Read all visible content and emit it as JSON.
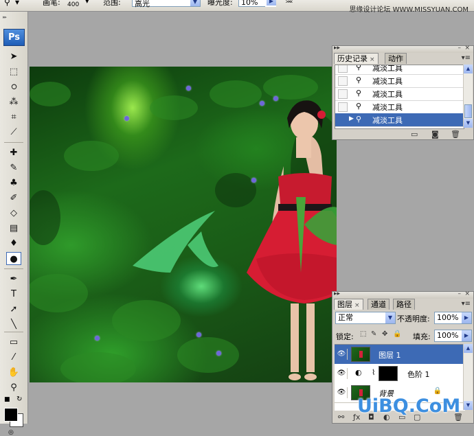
{
  "options_bar": {
    "brush_label": "画笔:",
    "brush_size": "400",
    "range_label": "范围:",
    "range_value": "高光",
    "exposure_label": "曝光度:",
    "exposure_value": "10%",
    "tool_icon": "dodge-tool-icon",
    "airbrush_icon": "airbrush-icon",
    "watermark": "思缘设计论坛 WWW.MISSYUAN.COM"
  },
  "toolbox": {
    "logo": "Ps",
    "tools": [
      {
        "name": "move-tool-icon",
        "glyph": "➤"
      },
      {
        "name": "marquee-tool-icon",
        "glyph": "⬚"
      },
      {
        "name": "lasso-tool-icon",
        "glyph": "ഠ"
      },
      {
        "name": "magic-wand-tool-icon",
        "glyph": "⁂"
      },
      {
        "name": "crop-tool-icon",
        "glyph": "⌗"
      },
      {
        "name": "eyedropper-slice-tool-icon",
        "glyph": "⟋"
      },
      {
        "name": "healing-brush-tool-icon",
        "glyph": "✚"
      },
      {
        "name": "brush-tool-icon",
        "glyph": "✎"
      },
      {
        "name": "clone-stamp-tool-icon",
        "glyph": "♣"
      },
      {
        "name": "history-brush-tool-icon",
        "glyph": "✐"
      },
      {
        "name": "eraser-tool-icon",
        "glyph": "◇"
      },
      {
        "name": "gradient-tool-icon",
        "glyph": "▤"
      },
      {
        "name": "blur-tool-icon",
        "glyph": "♦"
      },
      {
        "name": "dodge-tool-icon",
        "glyph": "●"
      },
      {
        "name": "pen-tool-icon",
        "glyph": "✒"
      },
      {
        "name": "type-tool-icon",
        "glyph": "T"
      },
      {
        "name": "path-selection-tool-icon",
        "glyph": "➚"
      },
      {
        "name": "line-tool-icon",
        "glyph": "╲"
      },
      {
        "name": "notes-tool-icon",
        "glyph": "▭"
      },
      {
        "name": "eyedropper-tool-icon",
        "glyph": "⁄"
      },
      {
        "name": "hand-tool-icon",
        "glyph": "✋"
      },
      {
        "name": "zoom-tool-icon",
        "glyph": "⚲"
      }
    ]
  },
  "history_panel": {
    "tabs": [
      {
        "label": "历史记录",
        "close": "×"
      },
      {
        "label": "动作"
      }
    ],
    "items": [
      {
        "label": "减淡工具",
        "selected": false
      },
      {
        "label": "减淡工具",
        "selected": false
      },
      {
        "label": "减淡工具",
        "selected": false
      },
      {
        "label": "减淡工具",
        "selected": false
      },
      {
        "label": "减淡工具",
        "selected": true
      }
    ]
  },
  "layers_panel": {
    "tabs": [
      {
        "label": "图层",
        "close": "×"
      },
      {
        "label": "通道"
      },
      {
        "label": "路径"
      }
    ],
    "blend_mode": "正常",
    "opacity_label": "不透明度:",
    "opacity_value": "100%",
    "lock_label": "锁定:",
    "fill_label": "填充:",
    "fill_value": "100%",
    "layers": [
      {
        "name": "图层 1",
        "selected": true
      },
      {
        "name": "色阶 1",
        "selected": false
      },
      {
        "name": "背景",
        "selected": false
      }
    ]
  },
  "watermark_bottom": "UiBQ.CoM",
  "colors": {
    "selection": "#3d6ab5",
    "panel_bg": "#d4d0c8",
    "workspace_bg": "#a6a6a6",
    "foreground": "#000000",
    "background": "#ffffff",
    "watermark": "#3d8fe0"
  }
}
